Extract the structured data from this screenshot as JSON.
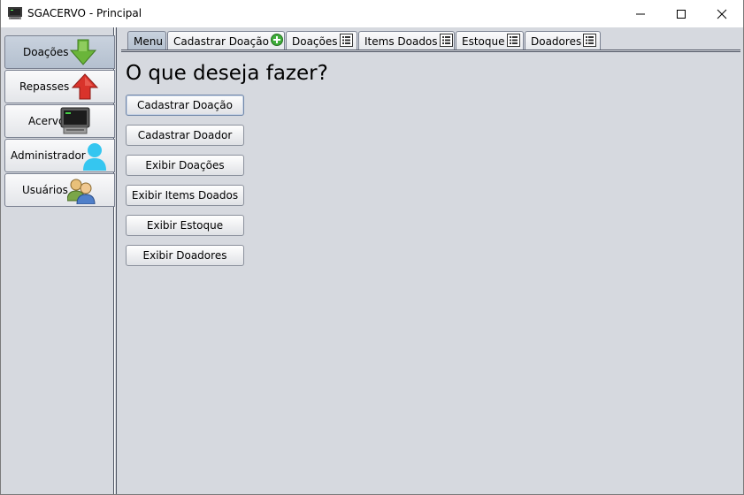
{
  "window": {
    "title": "SGACERVO - Principal",
    "icon": "computer-monitor-icon"
  },
  "sidebar": {
    "items": [
      {
        "label": "Doações",
        "icon": "green-down-arrow-icon",
        "active": true
      },
      {
        "label": "Repasses",
        "icon": "red-up-arrow-icon",
        "active": false
      },
      {
        "label": "Acervo",
        "icon": "computer-monitor-icon",
        "active": false
      },
      {
        "label": "Administrador",
        "icon": "user-silhouette-icon",
        "active": false
      },
      {
        "label": "Usuários",
        "icon": "users-group-icon",
        "active": false
      }
    ]
  },
  "tabs": [
    {
      "label": "Menu",
      "icon": "",
      "active": true
    },
    {
      "label": "Cadastrar Doação",
      "icon": "plus-circle-icon",
      "active": false
    },
    {
      "label": "Doações",
      "icon": "list-icon",
      "active": false
    },
    {
      "label": "Items Doados",
      "icon": "list-icon",
      "active": false
    },
    {
      "label": "Estoque",
      "icon": "list-icon",
      "active": false
    },
    {
      "label": "Doadores",
      "icon": "list-icon",
      "active": false
    }
  ],
  "main": {
    "heading": "O que deseja fazer?",
    "buttons": [
      {
        "label": "Cadastrar Doação"
      },
      {
        "label": "Cadastrar Doador"
      },
      {
        "label": "Exibir Doações"
      },
      {
        "label": "Exibir Items Doados"
      },
      {
        "label": "Exibir Estoque"
      },
      {
        "label": "Exibir Doadores"
      }
    ]
  },
  "colors": {
    "background": "#d6d9df",
    "active_tab": "#c0cad8",
    "border": "#4f5563"
  }
}
